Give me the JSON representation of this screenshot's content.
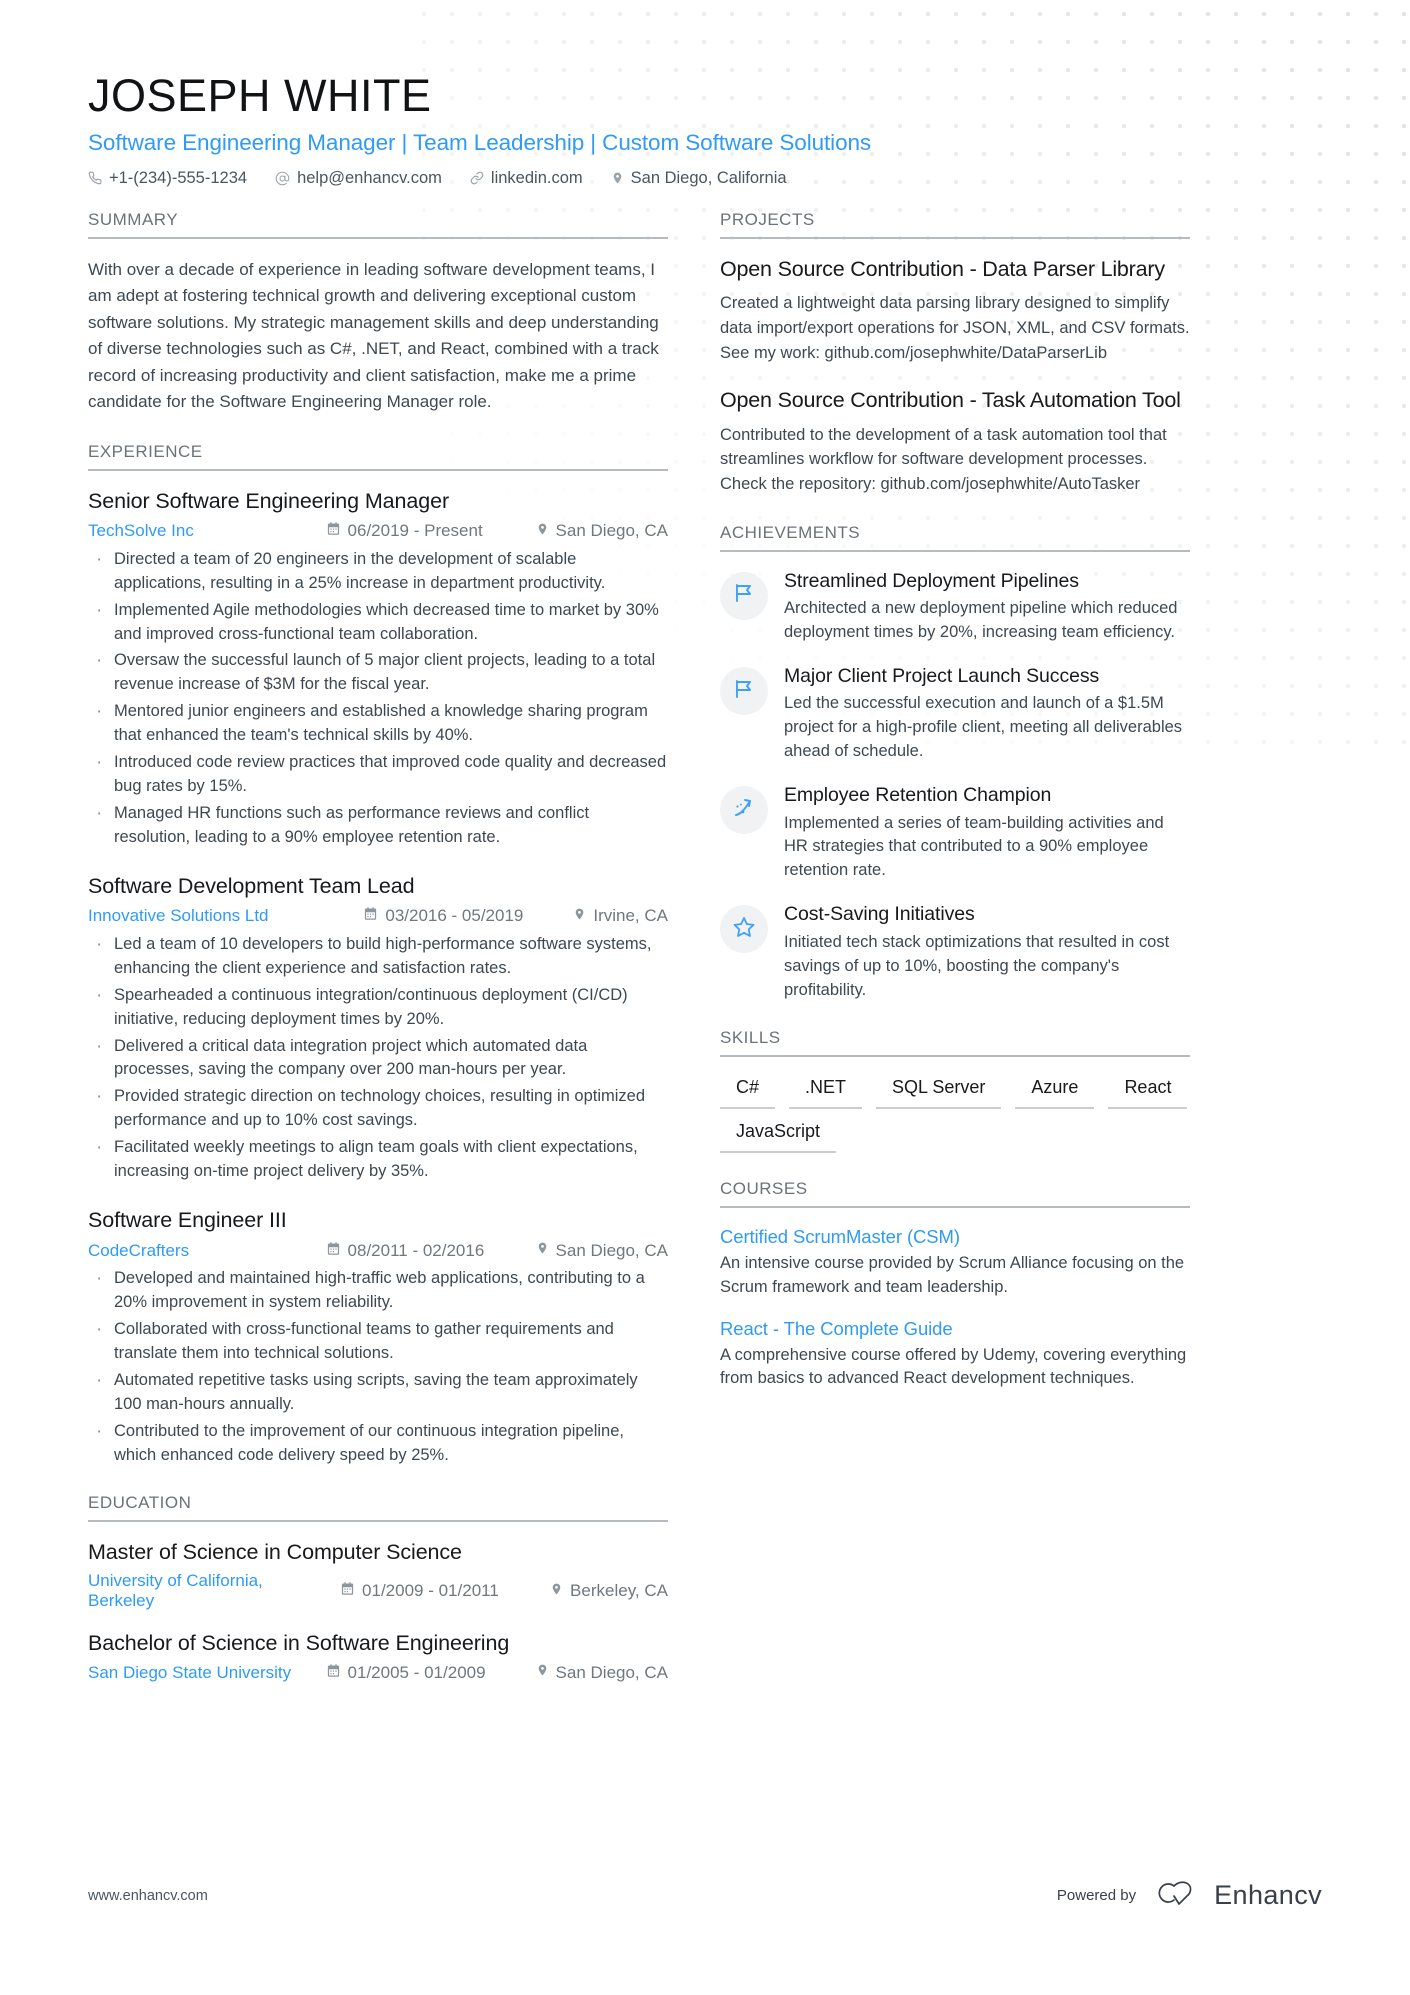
{
  "header": {
    "name": "JOSEPH WHITE",
    "title": "Software Engineering Manager | Team Leadership | Custom Software Solutions",
    "contacts": [
      {
        "icon": "phone-icon",
        "text": "+1-(234)-555-1234"
      },
      {
        "icon": "email-icon",
        "text": "help@enhancv.com"
      },
      {
        "icon": "link-icon",
        "text": "linkedin.com"
      },
      {
        "icon": "location-icon",
        "text": "San Diego, California"
      }
    ]
  },
  "sections": {
    "summary_heading": "SUMMARY",
    "experience_heading": "EXPERIENCE",
    "education_heading": "EDUCATION",
    "projects_heading": "PROJECTS",
    "achievements_heading": "ACHIEVEMENTS",
    "skills_heading": "SKILLS",
    "courses_heading": "COURSES"
  },
  "summary": {
    "text": "With over a decade of experience in leading software development teams, I am adept at fostering technical growth and delivering exceptional custom software solutions. My strategic management skills and deep understanding of diverse technologies such as C#, .NET, and React, combined with a track record of increasing productivity and client satisfaction, make me a prime candidate for the Software Engineering Manager role."
  },
  "experience": [
    {
      "title": "Senior Software Engineering Manager",
      "company": "TechSolve Inc",
      "dates": "06/2019 - Present",
      "location": "San Diego, CA",
      "bullets": [
        "Directed a team of 20 engineers in the development of scalable applications, resulting in a 25% increase in department productivity.",
        "Implemented Agile methodologies which decreased time to market by 30% and improved cross-functional team collaboration.",
        "Oversaw the successful launch of 5 major client projects, leading to a total revenue increase of $3M for the fiscal year.",
        "Mentored junior engineers and established a knowledge sharing program that enhanced the team's technical skills by 40%.",
        "Introduced code review practices that improved code quality and decreased bug rates by 15%.",
        "Managed HR functions such as performance reviews and conflict resolution, leading to a 90% employee retention rate."
      ]
    },
    {
      "title": "Software Development Team Lead",
      "company": "Innovative Solutions Ltd",
      "dates": "03/2016 - 05/2019",
      "location": "Irvine, CA",
      "bullets": [
        "Led a team of 10 developers to build high-performance software systems, enhancing the client experience and satisfaction rates.",
        "Spearheaded a continuous integration/continuous deployment (CI/CD) initiative, reducing deployment times by 20%.",
        "Delivered a critical data integration project which automated data processes, saving the company over 200 man-hours per year.",
        "Provided strategic direction on technology choices, resulting in optimized performance and up to 10% cost savings.",
        "Facilitated weekly meetings to align team goals with client expectations, increasing on-time project delivery by 35%."
      ]
    },
    {
      "title": "Software Engineer III",
      "company": "CodeCrafters",
      "dates": "08/2011 - 02/2016",
      "location": "San Diego, CA",
      "bullets": [
        "Developed and maintained high-traffic web applications, contributing to a 20% improvement in system reliability.",
        "Collaborated with cross-functional teams to gather requirements and translate them into technical solutions.",
        "Automated repetitive tasks using scripts, saving the team approximately 100 man-hours annually.",
        "Contributed to the improvement of our continuous integration pipeline, which enhanced code delivery speed by 25%."
      ]
    }
  ],
  "education": [
    {
      "degree": "Master of Science in Computer Science",
      "school": "University of California, Berkeley",
      "dates": "01/2009 - 01/2011",
      "location": "Berkeley, CA"
    },
    {
      "degree": "Bachelor of Science in Software Engineering",
      "school": "San Diego State University",
      "dates": "01/2005 - 01/2009",
      "location": "San Diego, CA"
    }
  ],
  "projects": [
    {
      "name": "Open Source Contribution - Data Parser Library",
      "description": "Created a lightweight data parsing library designed to simplify data import/export operations for JSON, XML, and CSV formats. See my work: github.com/josephwhite/DataParserLib"
    },
    {
      "name": "Open Source Contribution - Task Automation Tool",
      "description": "Contributed to the development of a task automation tool that streamlines workflow for software development processes. Check the repository: github.com/josephwhite/AutoTasker"
    }
  ],
  "achievements": [
    {
      "icon": "flag-icon",
      "title": "Streamlined Deployment Pipelines",
      "description": "Architected a new deployment pipeline which reduced deployment times by 20%, increasing team efficiency."
    },
    {
      "icon": "flag-icon",
      "title": "Major Client Project Launch Success",
      "description": "Led the successful execution and launch of a $1.5M project for a high-profile client, meeting all deliverables ahead of schedule."
    },
    {
      "icon": "growth-arrow-icon",
      "title": "Employee Retention Champion",
      "description": "Implemented a series of team-building activities and HR strategies that contributed to a 90% employee retention rate."
    },
    {
      "icon": "star-icon",
      "title": "Cost-Saving Initiatives",
      "description": "Initiated tech stack optimizations that resulted in cost savings of up to 10%, boosting the company's profitability."
    }
  ],
  "skills": [
    "C#",
    ".NET",
    "SQL Server",
    "Azure",
    "React",
    "JavaScript"
  ],
  "courses": [
    {
      "name": "Certified ScrumMaster (CSM)",
      "description": "An intensive course provided by Scrum Alliance focusing on the Scrum framework and team leadership."
    },
    {
      "name": "React - The Complete Guide",
      "description": "A comprehensive course offered by Udemy, covering everything from basics to advanced React development techniques."
    }
  ],
  "footer": {
    "url": "www.enhancv.com",
    "powered_by": "Powered by",
    "brand": "Enhancv"
  },
  "colors": {
    "accent": "#2f9bf5",
    "heading": "#6b7279",
    "body": "#3d4852",
    "rule": "#b6bbc0"
  }
}
